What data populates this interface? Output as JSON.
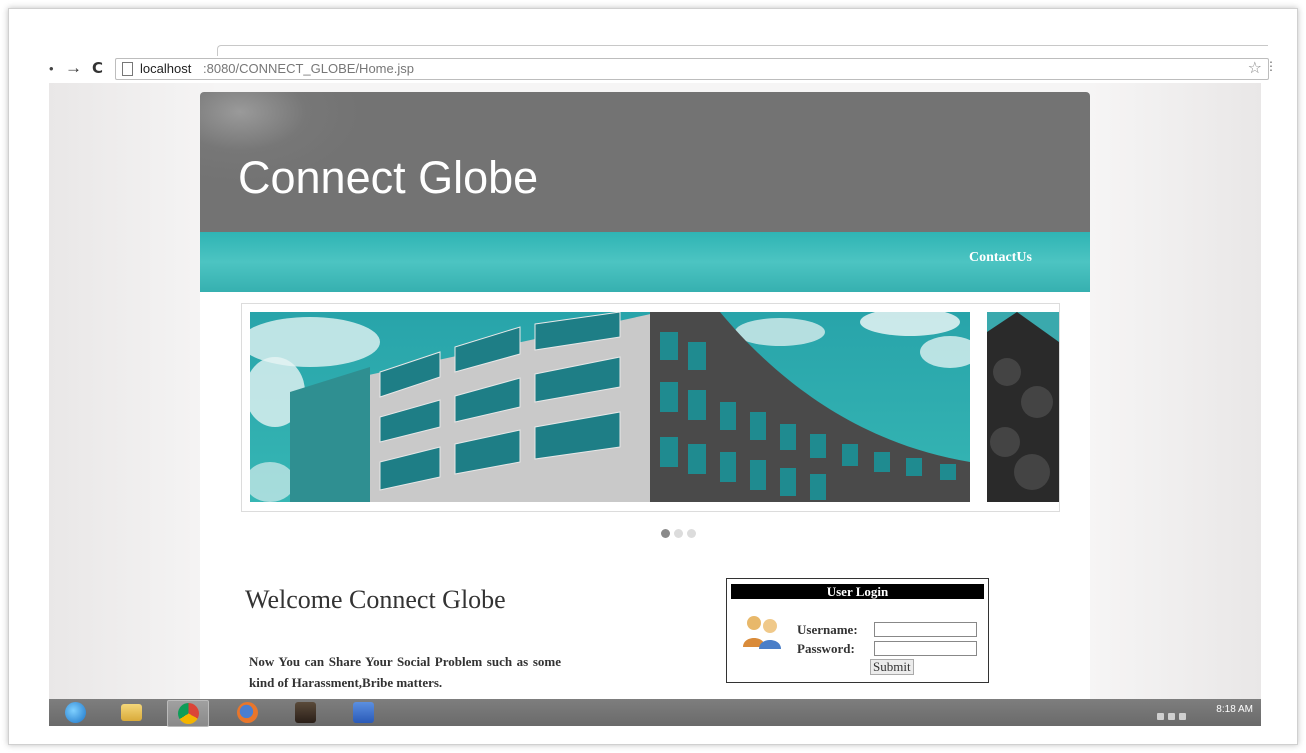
{
  "browser": {
    "url_host": "localhost",
    "url_rest": ":8080/CONNECT_GLOBE/Home.jsp"
  },
  "site": {
    "title": "Connect Globe",
    "nav": {
      "contact": "ContactUs"
    },
    "slider": {
      "dots": 3,
      "active_index": 0
    },
    "welcome": "Welcome Connect Globe",
    "intro": "Now You can Share Your Social Problem such as some kind of Harassment,Bribe matters."
  },
  "login": {
    "heading": "User Login",
    "username_label": "Username:",
    "password_label": "Password:",
    "username_value": "",
    "password_value": "",
    "submit_label": "Submit"
  },
  "taskbar": {
    "apps": [
      "ie-icon",
      "folder-icon",
      "chrome-icon",
      "firefox-icon",
      "media-icon",
      "word-icon"
    ],
    "active_app": "chrome-icon",
    "clock": "8:18 AM"
  },
  "colors": {
    "header_bg": "#737373",
    "nav_teal": "#3ebdbb",
    "accent_teal": "#2aa3a8"
  }
}
